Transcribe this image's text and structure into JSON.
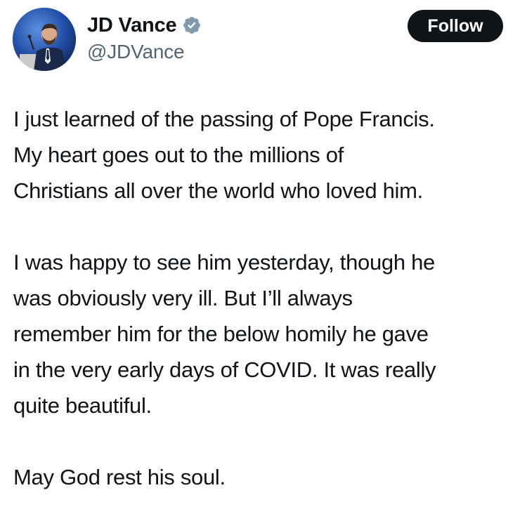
{
  "author": {
    "display_name": "JD Vance",
    "handle": "@JDVance",
    "verified_icon": "verified-badge-icon",
    "verified_color": "#829aab"
  },
  "actions": {
    "follow_label": "Follow"
  },
  "tweet": {
    "paragraphs": [
      {
        "lines": [
          "I just learned of the passing of Pope Francis.",
          "My heart goes out to the millions of",
          "Christians all over the world who loved him."
        ]
      },
      {
        "lines": [
          "I was happy to see him yesterday, though he",
          "was obviously very ill. But I’ll always",
          "remember him for the below homily he gave",
          "in the very early days of COVID. It was really",
          "quite beautiful."
        ]
      },
      {
        "lines": [
          "May God rest his soul."
        ]
      }
    ]
  },
  "colors": {
    "text_primary": "#0f1419",
    "text_secondary": "#536471",
    "button_bg": "#0f1419",
    "button_text": "#ffffff"
  }
}
